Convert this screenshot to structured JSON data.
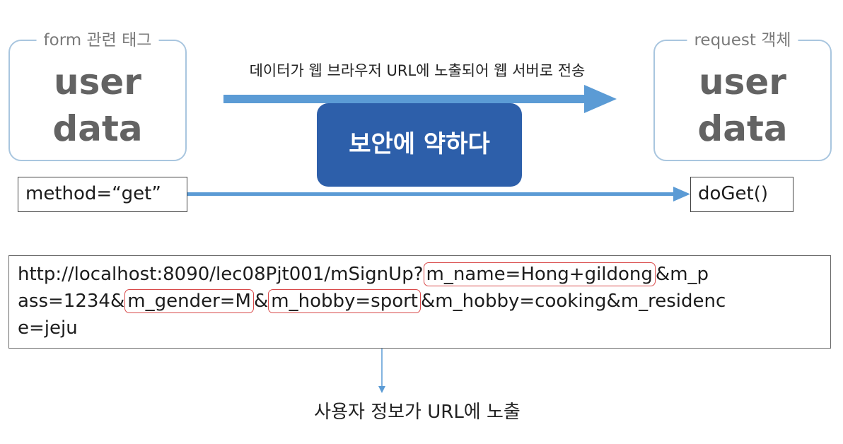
{
  "form_panel": {
    "caption": "form 관련 태그",
    "line1": "user",
    "line2": "data"
  },
  "request_panel": {
    "caption": "request 객체",
    "line1": "user",
    "line2": "data"
  },
  "transmit_label": "데이터가 웹 브라우저 URL에 노출되어 웹 서버로 전송",
  "security_badge": "보안에 약하다",
  "method_label": "method=“get”",
  "doget_label": "doGet()",
  "url": {
    "line1_prefix": "http://localhost:8090/lec08Pjt001/mSignUp?",
    "line1_param_name": "m_name=Hong+gildong",
    "line1_suffix": "&m_p",
    "line2_prefix": "ass=1234&",
    "line2_param_gender": "m_gender=M",
    "line2_sep": "&",
    "line2_param_hobby": "m_hobby=sport",
    "line2_suffix": "&m_hobby=cooking&m_residenc",
    "line3": "e=jeju"
  },
  "exposure_label": "사용자 정보가 URL에 노출",
  "colors": {
    "arrow_blue": "#5b9bd5",
    "badge_blue": "#2d5faa",
    "panel_border": "#a9c6df",
    "highlight_red": "#d94b4b"
  }
}
